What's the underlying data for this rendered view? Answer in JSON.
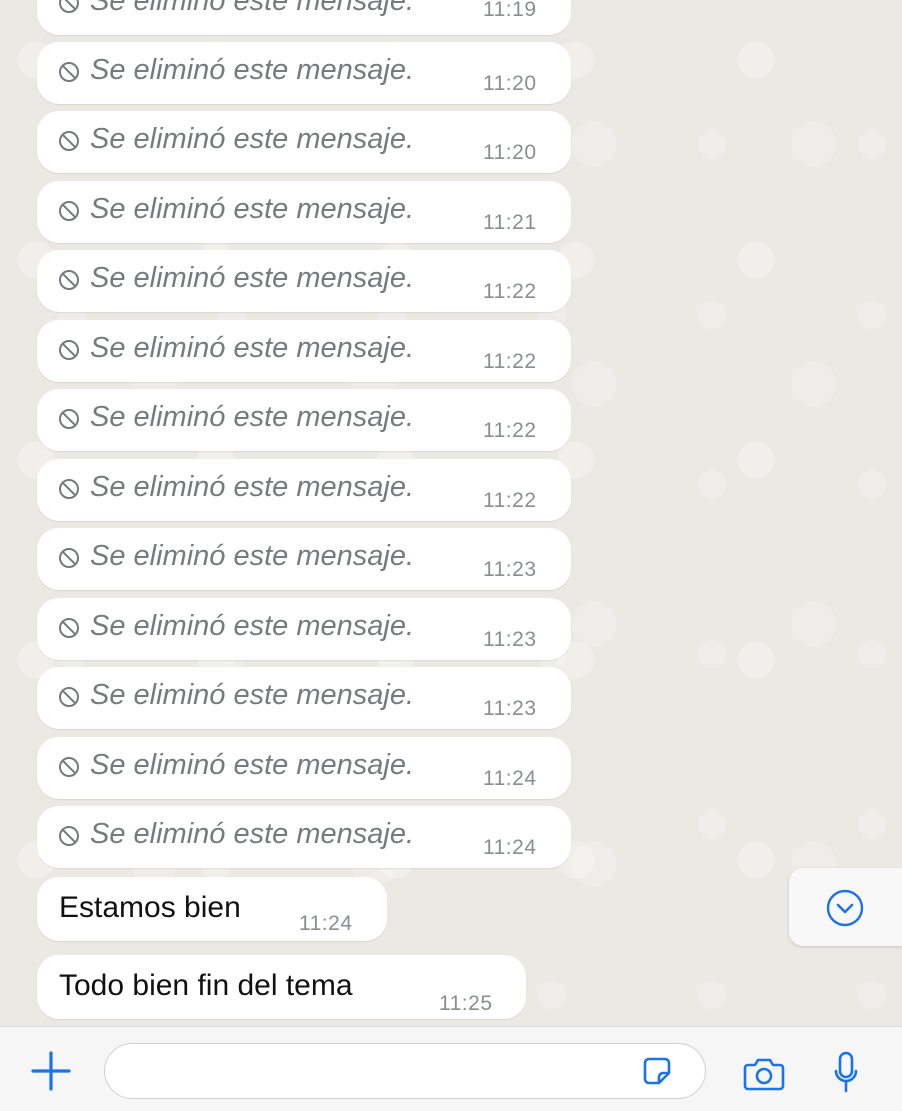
{
  "messages": [
    {
      "type": "deleted",
      "text": "Se eliminó este mensaje.",
      "time": "11:19"
    },
    {
      "type": "deleted",
      "text": "Se eliminó este mensaje.",
      "time": "11:20"
    },
    {
      "type": "deleted",
      "text": "Se eliminó este mensaje.",
      "time": "11:20"
    },
    {
      "type": "deleted",
      "text": "Se eliminó este mensaje.",
      "time": "11:21"
    },
    {
      "type": "deleted",
      "text": "Se eliminó este mensaje.",
      "time": "11:22"
    },
    {
      "type": "deleted",
      "text": "Se eliminó este mensaje.",
      "time": "11:22"
    },
    {
      "type": "deleted",
      "text": "Se eliminó este mensaje.",
      "time": "11:22"
    },
    {
      "type": "deleted",
      "text": "Se eliminó este mensaje.",
      "time": "11:22"
    },
    {
      "type": "deleted",
      "text": "Se eliminó este mensaje.",
      "time": "11:23"
    },
    {
      "type": "deleted",
      "text": "Se eliminó este mensaje.",
      "time": "11:23"
    },
    {
      "type": "deleted",
      "text": "Se eliminó este mensaje.",
      "time": "11:23"
    },
    {
      "type": "deleted",
      "text": "Se eliminó este mensaje.",
      "time": "11:24"
    },
    {
      "type": "deleted",
      "text": "Se eliminó este mensaje.",
      "time": "11:24"
    },
    {
      "type": "text",
      "text": "Estamos bien",
      "time": "11:24"
    },
    {
      "type": "text",
      "text": "Todo bien fin del tema",
      "time": "11:25"
    }
  ],
  "input": {
    "placeholder": "",
    "value": ""
  },
  "icons": {
    "deleted": "prohibited-icon",
    "scroll": "chevron-down-circle-icon",
    "attach": "plus-icon",
    "sticker": "sticker-icon",
    "camera": "camera-icon",
    "mic": "microphone-icon"
  },
  "colors": {
    "accent": "#1a73e8",
    "bubble": "#ffffff",
    "background": "#ebe9e4"
  }
}
